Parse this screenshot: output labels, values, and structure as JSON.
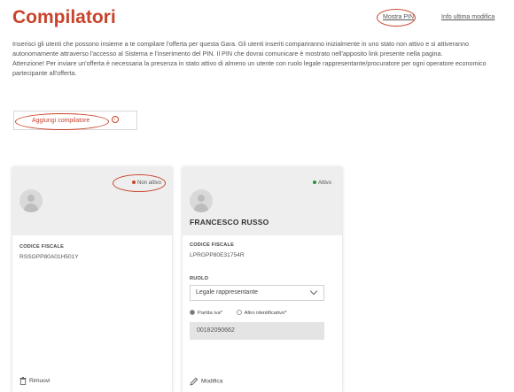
{
  "page": {
    "title": "Compilatori",
    "links": {
      "show_pin": "Mostra PIN",
      "last_edit_info": "Info ultima modifica"
    },
    "intro": [
      "Inserisci gli utenti che possono insieme a te compilare l'offerta per questa Gara. Gli utenti inseriti compariranno inizialmente in uno stato non attivo e si attiveranno autonomamente attraverso l'accesso al Sistema e l'inserimento del PIN. Il PIN che dovrai comunicare è mostrato nell'apposito link presente nella pagina.",
      "Attenzione! Per inviare un'offerta è necessaria la presenza in stato attivo di almeno un utente con ruolo legale rappresentante/procuratore per ogni operatore economico partecipante all'offerta."
    ],
    "add_button_label": "Aggiungi compilatore"
  },
  "cards": [
    {
      "status": "Non attivo",
      "status_color": "#c8442c",
      "fiscal_code_label": "CODICE FISCALE",
      "fiscal_code": "RSSGPP80A01H501Y",
      "action_label": "Rimuovi",
      "action_icon": "trash-icon"
    },
    {
      "status": "Attivo",
      "status_color": "#2e8b3a",
      "name": "FRANCESCO RUSSO",
      "fiscal_code_label": "CODICE FISCALE",
      "fiscal_code": "LPRGPP80E31754R",
      "role_label": "RUOLO",
      "role_value": "Legale rappresentante",
      "radio_partita_iva": "Partita iva*",
      "radio_altro": "Altro identificativo*",
      "partita_iva_value": "00182090662",
      "action_label": "Modifica",
      "action_icon": "pencil-icon"
    }
  ],
  "colors": {
    "accent": "#c8442c",
    "active": "#2e8b3a"
  }
}
